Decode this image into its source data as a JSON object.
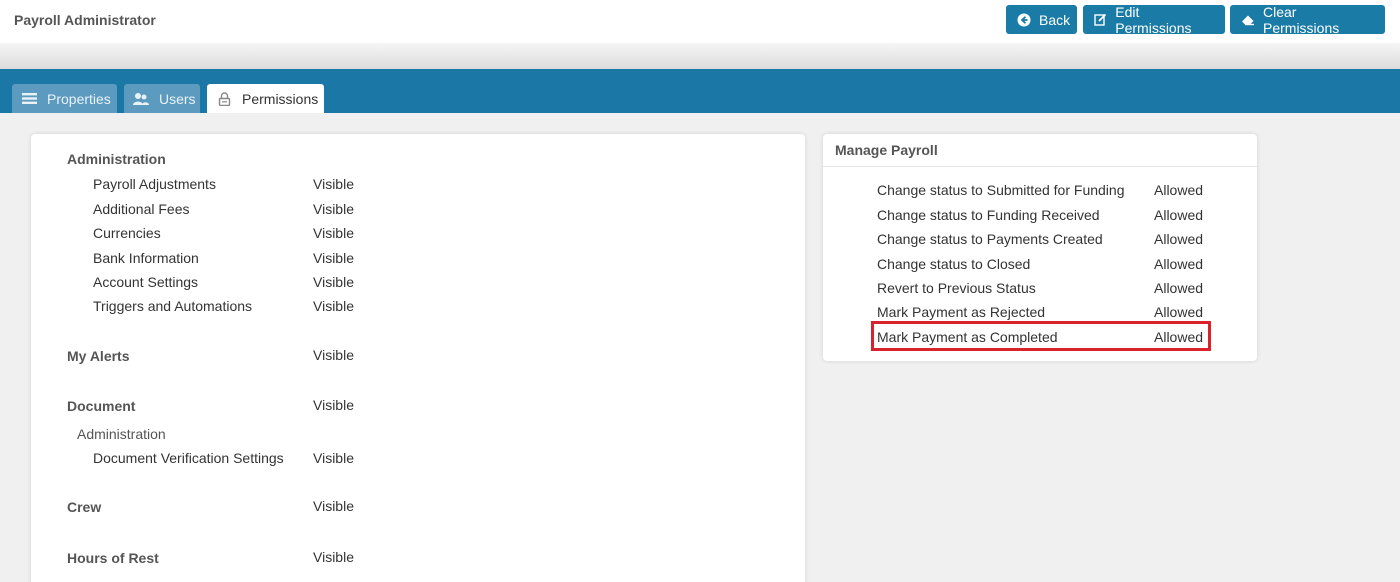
{
  "header": {
    "title": "Payroll Administrator",
    "buttons": {
      "back": "Back",
      "edit": "Edit Permissions",
      "clear": "Clear Permissions"
    }
  },
  "tabs": {
    "properties": "Properties",
    "users": "Users",
    "permissions": "Permissions"
  },
  "left_panel": {
    "administration": {
      "title": "Administration",
      "items": [
        {
          "label": "Payroll Adjustments",
          "value": "Visible"
        },
        {
          "label": "Additional Fees",
          "value": "Visible"
        },
        {
          "label": "Currencies",
          "value": "Visible"
        },
        {
          "label": "Bank Information",
          "value": "Visible"
        },
        {
          "label": "Account Settings",
          "value": "Visible"
        },
        {
          "label": "Triggers and Automations",
          "value": "Visible"
        }
      ]
    },
    "my_alerts": {
      "title": "My Alerts",
      "value": "Visible"
    },
    "document": {
      "title": "Document",
      "value": "Visible",
      "sub_title": "Administration",
      "items": [
        {
          "label": "Document Verification Settings",
          "value": "Visible"
        }
      ]
    },
    "crew": {
      "title": "Crew",
      "value": "Visible"
    },
    "hours_of_rest": {
      "title": "Hours of Rest",
      "value": "Visible"
    }
  },
  "right_panel": {
    "title": "Manage Payroll",
    "items": [
      {
        "label": "Change status to Submitted for Funding",
        "value": "Allowed"
      },
      {
        "label": "Change status to Funding Received",
        "value": "Allowed"
      },
      {
        "label": "Change status to Payments Created",
        "value": "Allowed"
      },
      {
        "label": "Change status to Closed",
        "value": "Allowed"
      },
      {
        "label": "Revert to Previous Status",
        "value": "Allowed"
      },
      {
        "label": "Mark Payment as Rejected",
        "value": "Allowed"
      },
      {
        "label": "Mark Payment as Completed",
        "value": "Allowed"
      }
    ],
    "highlighted_item": "Mark Payment as Completed"
  },
  "colors": {
    "primary": "#1b78a6",
    "button": "#1a7ba7",
    "highlight": "#d9232a"
  },
  "icons": {
    "back": "circle-arrow-left-icon",
    "edit": "edit-icon",
    "clear": "eraser-icon",
    "properties": "list-icon",
    "users": "users-icon",
    "permissions": "lock-icon"
  }
}
